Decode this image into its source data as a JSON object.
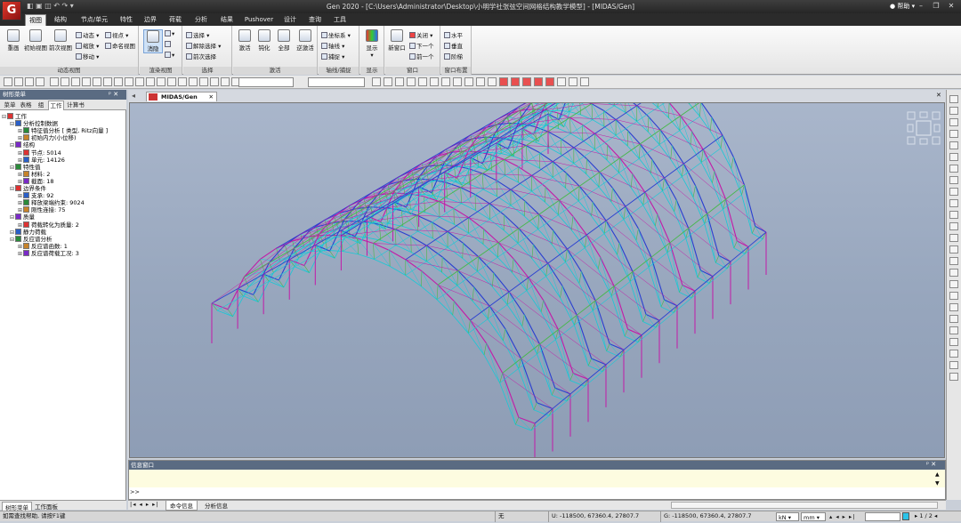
{
  "app": {
    "title": "Gen 2020 - [C:\\Users\\Administrator\\Desktop\\小明学社张弦空间网格结构教学模型] - [MIDAS/Gen]",
    "logo": "G",
    "help_label": "帮助"
  },
  "tabs": [
    "视图",
    "结构",
    "节点/单元",
    "特性",
    "边界",
    "荷载",
    "分析",
    "结果",
    "Pushover",
    "设计",
    "查询",
    "工具"
  ],
  "active_tab": "视图",
  "ribbon": {
    "groups": [
      {
        "label": "动态视图",
        "buttons": [
          "重画",
          "初始视图",
          "前次视图"
        ],
        "small": [
          "动态 ▾",
          "缩放 ▾",
          "移动 ▾",
          "视点 ▾",
          "命名视图"
        ]
      },
      {
        "label": "渲染视图",
        "buttons": [
          "消隐"
        ],
        "small": []
      },
      {
        "label": "选择",
        "buttons": [],
        "small": [
          "选择 ▾",
          "解除选择 ▾",
          "前次选择"
        ]
      },
      {
        "label": "激活",
        "buttons": [
          "激活",
          "钝化",
          "全部",
          "逆激活"
        ],
        "small": []
      },
      {
        "label": "轴线/捕捉",
        "buttons": [],
        "small": [
          "坐标系 ▾",
          "轴线 ▾",
          "捕捉 ▾"
        ]
      },
      {
        "label": "显示",
        "buttons": [
          "显示"
        ],
        "small": []
      },
      {
        "label": "窗口",
        "buttons": [
          "新窗口"
        ],
        "small": [
          "关闭 ▾",
          "下一个",
          "前一个"
        ]
      },
      {
        "label": "窗口布置",
        "buttons": [],
        "small": [
          "水平",
          "垂直",
          "阶梯"
        ]
      }
    ]
  },
  "left_panel": {
    "header": "树形菜单",
    "tabs": [
      "菜单",
      "表格",
      "组",
      "工作",
      "计算书"
    ],
    "active_tab": "工作",
    "tree": [
      {
        "level": 0,
        "text": "工作"
      },
      {
        "level": 1,
        "text": "分析控制数据"
      },
      {
        "level": 2,
        "text": "特征值分析 [ 类型, Ritz向量 ]"
      },
      {
        "level": 2,
        "text": "初始内力(小位移)"
      },
      {
        "level": 1,
        "text": "结构"
      },
      {
        "level": 2,
        "text": "节点: 5014"
      },
      {
        "level": 2,
        "text": "单元: 14126"
      },
      {
        "level": 1,
        "text": "特性值"
      },
      {
        "level": 2,
        "text": "材料: 2"
      },
      {
        "level": 2,
        "text": "截面: 18"
      },
      {
        "level": 1,
        "text": "边界条件"
      },
      {
        "level": 2,
        "text": "支承: 92"
      },
      {
        "level": 2,
        "text": "释放梁端约束: 9024"
      },
      {
        "level": 2,
        "text": "刚性连接: 75"
      },
      {
        "level": 1,
        "text": "质量"
      },
      {
        "level": 2,
        "text": "荷载转化为质量: 2"
      },
      {
        "level": 1,
        "text": "静力荷载"
      },
      {
        "level": 1,
        "text": "反应谱分析"
      },
      {
        "level": 2,
        "text": "反应谱函数: 1"
      },
      {
        "level": 2,
        "text": "反应谱荷载工况: 3"
      }
    ],
    "bottom_tabs": [
      "树形菜单",
      "工作面板"
    ]
  },
  "document": {
    "tab": "MIDAS/Gen"
  },
  "message_window": {
    "title": "信息窗口",
    "prompt": ">>",
    "tabs": [
      "命令信息",
      "分析信息"
    ]
  },
  "status": {
    "help": "如需查找帮助, 请按F1键",
    "sel": "无",
    "ucs": "U: -118500, 67360.4, 27807.7",
    "gcs": "G: -118500, 67360.4, 27807.7",
    "force_unit": "kN",
    "length_unit": "mm",
    "page": "1 / 2"
  },
  "colors": {
    "titlebar": "#2b2b2b",
    "panel_head": "#5a6b82",
    "viewport": "#9aa9c0",
    "frame_blue": "#2a3fd0",
    "frame_magenta": "#c21aa8",
    "frame_cyan": "#17c9d6",
    "frame_green": "#46b84a"
  }
}
